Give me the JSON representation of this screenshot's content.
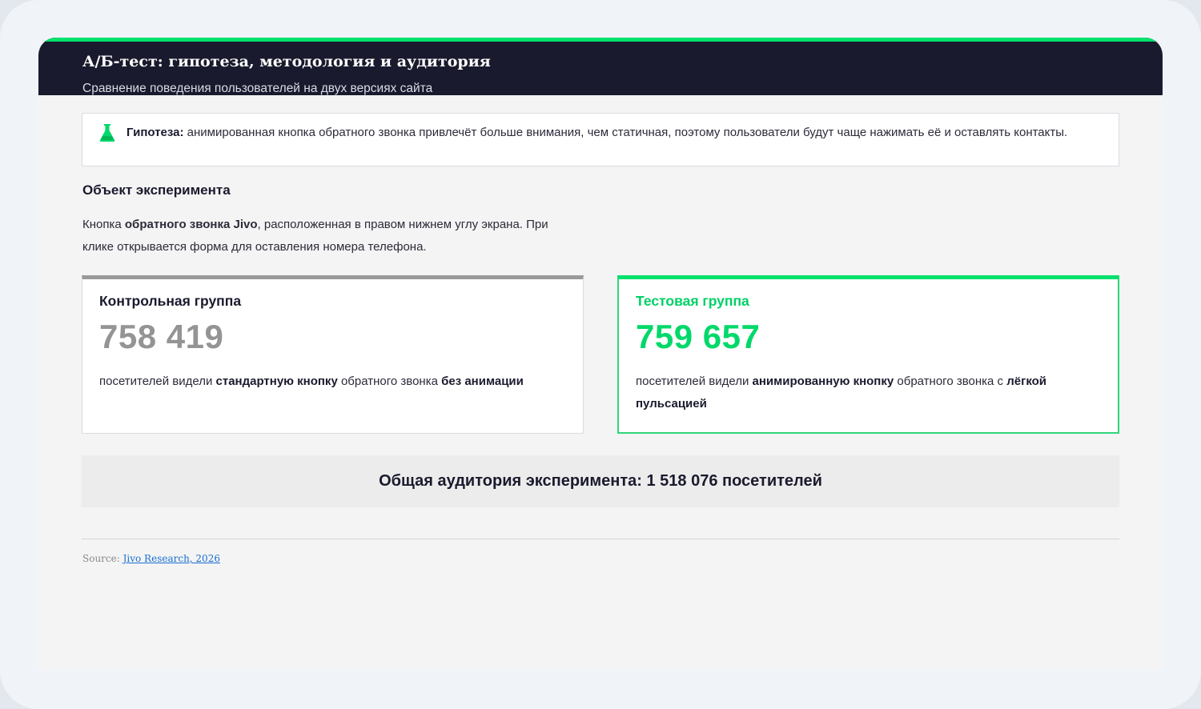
{
  "header": {
    "title": "А/Б-тест: гипотеза, методология и аудитория",
    "subtitle": "Сравнение поведения пользователей на двух версиях сайта"
  },
  "hypothesis": {
    "icon": "flask-icon",
    "label": "Гипотеза:",
    "text": " анимированная кнопка обратного звонка привлечёт больше внимания, чем статичная, поэтому пользователи будут чаще нажимать её и оставлять контакты."
  },
  "object": {
    "title": "Объект эксперимента",
    "desc_prefix": "Кнопка ",
    "desc_bold": "обратного звонка Jivo",
    "desc_suffix": ", расположенная в правом нижнем углу экрана. При клике открывается форма для оставления номера телефона."
  },
  "groups": [
    {
      "label": "Контрольная группа",
      "count": "758 419",
      "desc_1": "посетителей видели ",
      "desc_2": "стандартную кнопку",
      "desc_3": " обратного звонка ",
      "desc_4": "без анимации",
      "accent": "#9a9a9a"
    },
    {
      "label": "Тестовая группа",
      "count": "759 657",
      "desc_1": "посетителей видели ",
      "desc_2": "анимированную кнопку",
      "desc_3": " обратного звонка с ",
      "desc_4": "лёгкой пульсацией",
      "accent": "#00e16d"
    }
  ],
  "total": {
    "text": "Общая аудитория эксперимента: 1 518 076 посетителей"
  },
  "source": {
    "label": "Source: ",
    "link": "Jivo Research, 2026"
  },
  "colors": {
    "accent_green": "#00e16d",
    "header_bg": "#1a1a2e",
    "control_gray": "#9a9a9a"
  }
}
